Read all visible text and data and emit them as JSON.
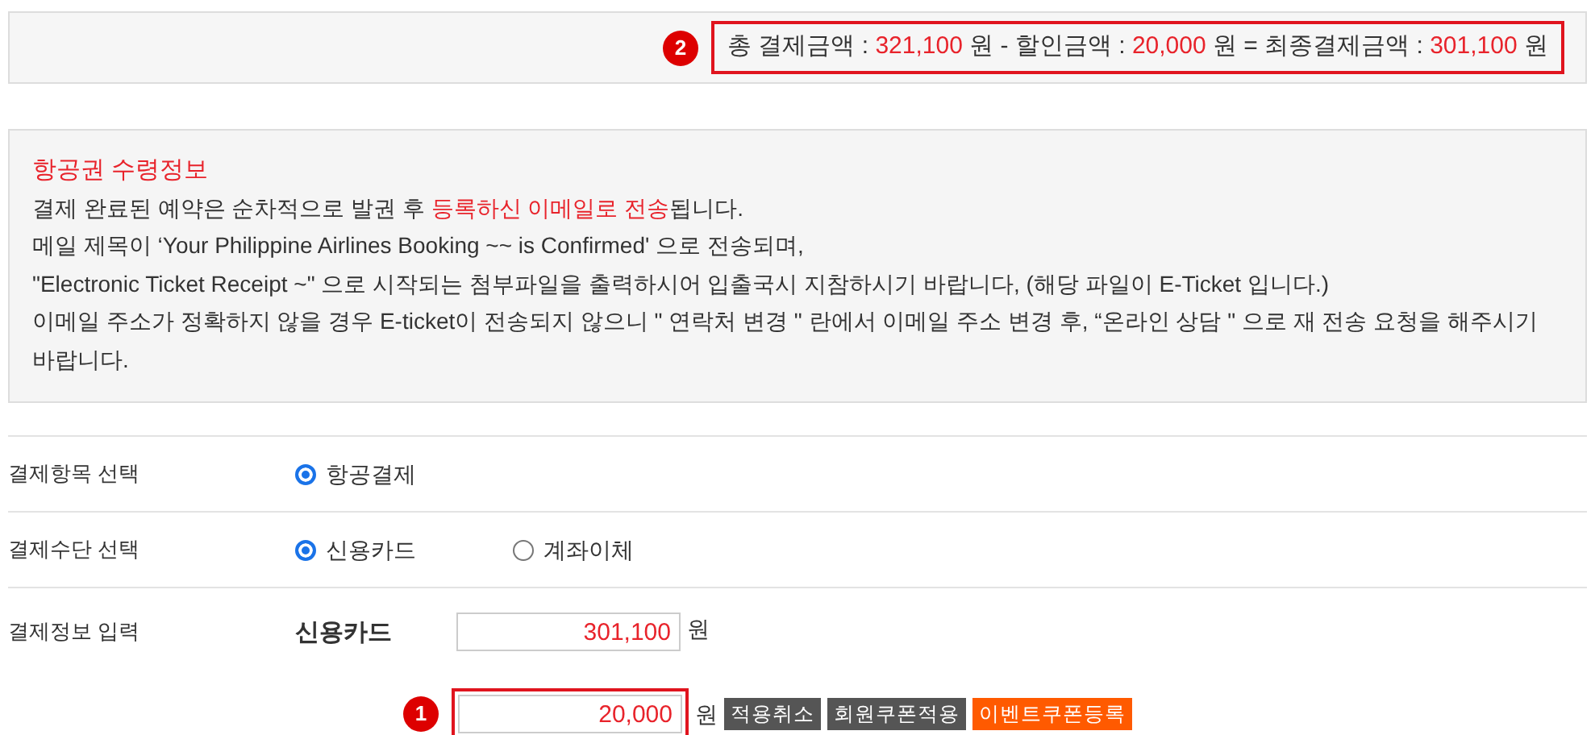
{
  "summary": {
    "marker": "2",
    "segments": [
      {
        "text": "총 결제금액 : ",
        "highlight": false
      },
      {
        "text": "321,100",
        "highlight": true
      },
      {
        "text": " 원 - 할인금액 : ",
        "highlight": false
      },
      {
        "text": "20,000",
        "highlight": true
      },
      {
        "text": " 원 = 최종결제금액 : ",
        "highlight": false
      },
      {
        "text": "301,100",
        "highlight": true
      },
      {
        "text": " 원",
        "highlight": false
      }
    ]
  },
  "notice": {
    "title": "항공권 수령정보",
    "lines": [
      [
        {
          "text": "결제 완료된 예약은 순차적으로 발권 후 ",
          "highlight": false
        },
        {
          "text": "등록하신 이메일로 전송",
          "highlight": true
        },
        {
          "text": "됩니다.",
          "highlight": false
        }
      ],
      [
        {
          "text": "메일 제목이 ‘Your Philippine Airlines Booking ~~ is Confirmed' 으로 전송되며,",
          "highlight": false
        }
      ],
      [
        {
          "text": "\"Electronic Ticket Receipt ~\" 으로 시작되는 첨부파일을 출력하시어 입출국시 지참하시기 바랍니다, (해당 파일이 E-Ticket 입니다.)",
          "highlight": false
        }
      ],
      [
        {
          "text": "이메일 주소가 정확하지 않을 경우 E-ticket이 전송되지 않으니  \" 연락처 변경 \" 란에서 이메일 주소 변경 후, “온라인 상담 \" 으로 재 전송 요청을 해주시기 바랍니다.",
          "highlight": false
        }
      ]
    ]
  },
  "form": [
    {
      "label": "결제항목 선택",
      "kind": "radio",
      "options": [
        {
          "label": "항공결제",
          "selected": true
        }
      ]
    },
    {
      "label": "결제수단 선택",
      "kind": "radio",
      "options": [
        {
          "label": "신용카드",
          "selected": true
        },
        {
          "label": "계좌이체",
          "selected": false
        }
      ]
    },
    {
      "label": "결제정보 입력",
      "kind": "payment",
      "method": "신용카드",
      "amount": "301,100",
      "unit": "원"
    }
  ],
  "coupon": {
    "marker": "1",
    "value": "20,000",
    "unit": "원",
    "buttons": [
      {
        "label": "적용취소",
        "kind": "dark"
      },
      {
        "label": "회원쿠폰적용",
        "kind": "dark"
      },
      {
        "label": "이벤트쿠폰등록",
        "kind": "orange"
      }
    ]
  }
}
